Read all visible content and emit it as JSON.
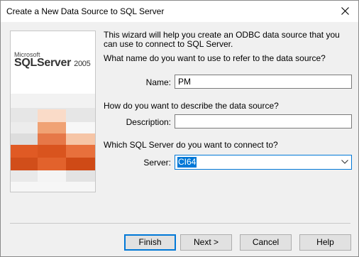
{
  "window": {
    "title": "Create a New Data Source to SQL Server"
  },
  "banner": {
    "brand_small": "Microsoft",
    "brand_product": "SQLServer",
    "brand_version": "2005"
  },
  "intro_text": "This wizard will help you create an ODBC data source that you can use to connect to SQL Server.",
  "name_section": {
    "question": "What name do you want to use to refer to the data source?",
    "label": "Name:",
    "value": "PM"
  },
  "description_section": {
    "question": "How do you want to describe the data source?",
    "label": "Description:",
    "value": ""
  },
  "server_section": {
    "question": "Which SQL Server do you want to connect to?",
    "label": "Server:",
    "value": "CI64"
  },
  "buttons": {
    "finish": "Finish",
    "next": "Next >",
    "cancel": "Cancel",
    "help": "Help"
  },
  "colors": {
    "accent": "#0078d7",
    "orange_dark": "#d9541e",
    "orange_light": "#f0a274"
  }
}
